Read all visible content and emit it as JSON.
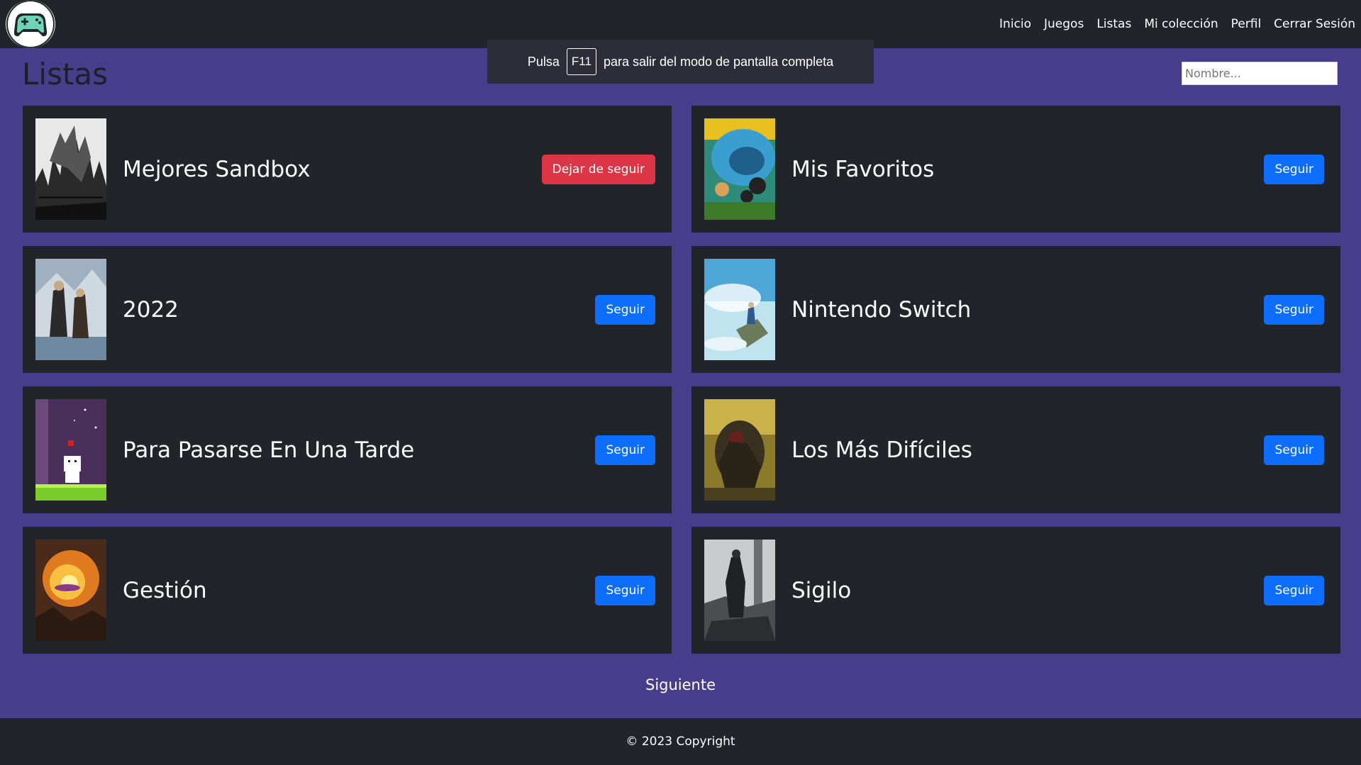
{
  "navbar": {
    "logo_icon": "gamepad-logo-icon",
    "links": [
      {
        "label": "Inicio"
      },
      {
        "label": "Juegos"
      },
      {
        "label": "Listas"
      },
      {
        "label": "Mi colección"
      },
      {
        "label": "Perfil"
      },
      {
        "label": "Cerrar Sesión"
      }
    ]
  },
  "fullscreen_notice": {
    "prefix": "Pulsa",
    "key": "F11",
    "suffix": "para salir del modo de pantalla completa"
  },
  "page": {
    "title": "Listas",
    "search_placeholder": "Nombre..."
  },
  "lists": [
    {
      "title": "Mejores Sandbox",
      "button": "Dejar de seguir",
      "following": true
    },
    {
      "title": "Mis Favoritos",
      "button": "Seguir",
      "following": false
    },
    {
      "title": "2022",
      "button": "Seguir",
      "following": false
    },
    {
      "title": "Nintendo Switch",
      "button": "Seguir",
      "following": false
    },
    {
      "title": "Para Pasarse En Una Tarde",
      "button": "Seguir",
      "following": false
    },
    {
      "title": "Los Más Difíciles",
      "button": "Seguir",
      "following": false
    },
    {
      "title": "Gestión",
      "button": "Seguir",
      "following": false
    },
    {
      "title": "Sigilo",
      "button": "Seguir",
      "following": false
    }
  ],
  "pagination": {
    "next_label": "Siguiente"
  },
  "footer": {
    "text": "© 2023 Copyright"
  },
  "colors": {
    "background": "#483d8b",
    "navbar": "#212529",
    "card": "#212529",
    "follow_button": "#0d6efd",
    "unfollow_button": "#dc3545"
  }
}
